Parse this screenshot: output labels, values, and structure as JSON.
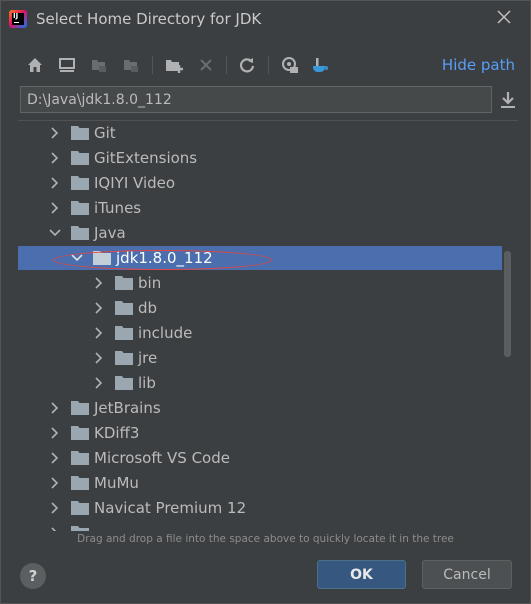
{
  "window": {
    "title": "Select Home Directory for JDK"
  },
  "toolbar": {
    "buttons": [
      "home-icon",
      "desktop-icon",
      "project-icon",
      "module-icon",
      "new-folder-icon",
      "delete-icon",
      "refresh-icon",
      "show-hidden-icon",
      "jdk-cup-icon"
    ],
    "hide_path_label": "Hide path"
  },
  "path_field": {
    "value": "D:\\Java\\jdk1.8.0_112"
  },
  "tree": {
    "items": [
      {
        "label": "Git",
        "depth": 0,
        "expanded": false
      },
      {
        "label": "GitExtensions",
        "depth": 0,
        "expanded": false
      },
      {
        "label": "IQIYI Video",
        "depth": 0,
        "expanded": false
      },
      {
        "label": "iTunes",
        "depth": 0,
        "expanded": false
      },
      {
        "label": "Java",
        "depth": 0,
        "expanded": true
      },
      {
        "label": "jdk1.8.0_112",
        "depth": 1,
        "expanded": true,
        "selected": true
      },
      {
        "label": "bin",
        "depth": 2,
        "expanded": false
      },
      {
        "label": "db",
        "depth": 2,
        "expanded": false
      },
      {
        "label": "include",
        "depth": 2,
        "expanded": false
      },
      {
        "label": "jre",
        "depth": 2,
        "expanded": false
      },
      {
        "label": "lib",
        "depth": 2,
        "expanded": false
      },
      {
        "label": "JetBrains",
        "depth": 0,
        "expanded": false
      },
      {
        "label": "KDiff3",
        "depth": 0,
        "expanded": false
      },
      {
        "label": "Microsoft VS Code",
        "depth": 0,
        "expanded": false
      },
      {
        "label": "MuMu",
        "depth": 0,
        "expanded": false
      },
      {
        "label": "Navicat Premium 12",
        "depth": 0,
        "expanded": false
      }
    ]
  },
  "hint": "Drag and drop a file into the space above to quickly locate it in the tree",
  "footer": {
    "help_label": "?",
    "ok_label": "OK",
    "cancel_label": "Cancel"
  },
  "colors": {
    "background": "#3c3f41",
    "selection": "#4b6eaf",
    "link": "#589df6",
    "annotation": "#e8453c"
  }
}
